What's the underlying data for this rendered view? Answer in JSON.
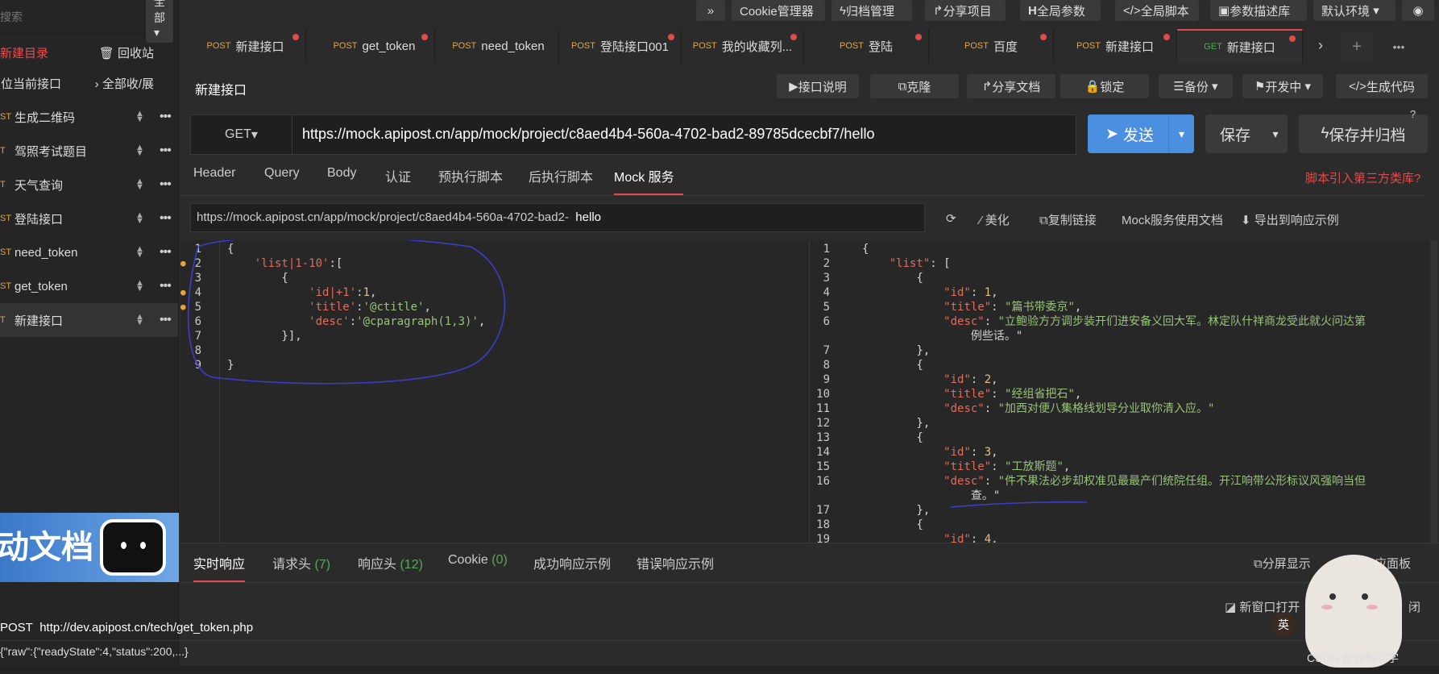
{
  "sidebar": {
    "search_placeholder": "搜索",
    "filter": "全部",
    "new_dir": "新建目录",
    "recycle": "回收站",
    "locate": "定位当前接口",
    "collapse": "全部收/展",
    "items": [
      {
        "method": "ST",
        "label": "生成二维码"
      },
      {
        "method": "T",
        "label": "驾照考试题目"
      },
      {
        "method": "T",
        "label": "天气查询"
      },
      {
        "method": "ST",
        "label": "登陆接口"
      },
      {
        "method": "ST",
        "label": "need_token"
      },
      {
        "method": "ST",
        "label": "get_token"
      },
      {
        "method": "T",
        "label": "新建接口"
      }
    ],
    "promo_text": "动文档"
  },
  "toolbar": {
    "expand": "»",
    "cookie": "Cookie管理器",
    "archive": "归档管理",
    "share_project": "分享项目",
    "global_params": "全局参数",
    "global_script": "全局脚本",
    "param_lib": "参数描述库",
    "env": "默认环境"
  },
  "tabs": [
    {
      "method": "POST",
      "label": "新建接口"
    },
    {
      "method": "POST",
      "label": "get_token"
    },
    {
      "method": "POST",
      "label": "need_token"
    },
    {
      "method": "POST",
      "label": "登陆接口001"
    },
    {
      "method": "POST",
      "label": "我的收藏列..."
    },
    {
      "method": "POST",
      "label": "登陆"
    },
    {
      "method": "POST",
      "label": "百度"
    },
    {
      "method": "POST",
      "label": "新建接口"
    },
    {
      "method": "GET",
      "label": "新建接口"
    }
  ],
  "api": {
    "title": "新建接口",
    "doc": "接口说明",
    "clone": "克隆",
    "share_doc": "分享文档",
    "lock": "锁定",
    "backup": "备份",
    "status": "开发中",
    "gen_code": "生成代码",
    "method": "GET",
    "url": "https://mock.apipost.cn/app/mock/project/c8aed4b4-560a-4702-bad2-89785dcecbf7/hello",
    "send": "发送",
    "save": "保存",
    "save_archive": "保存并归档"
  },
  "req_tabs": [
    "Header",
    "Query",
    "Body",
    "认证",
    "预执行脚本",
    "后执行脚本",
    "Mock 服务"
  ],
  "third_party": "脚本引入第三方类库?",
  "mock": {
    "url_prefix": "https://mock.apipost.cn/app/mock/project/c8aed4b4-560a-4702-bad2-",
    "url_suffix": "hello",
    "beautify": "美化",
    "copy_link": "复制链接",
    "doc": "Mock服务使用文档",
    "export": "导出到响应示例"
  },
  "left_code": [
    "{",
    "    'list|1-10':[",
    "        {",
    "            'id|+1':1,",
    "            'title':'@ctitle',",
    "            'desc':'@cparagraph(1,3)',",
    "        }],",
    "",
    "}"
  ],
  "right_code": [
    {
      "no": "1",
      "text": "{"
    },
    {
      "no": "2",
      "text": "    \"list\": ["
    },
    {
      "no": "3",
      "text": "        {"
    },
    {
      "no": "4",
      "text": "            \"id\": 1,"
    },
    {
      "no": "5",
      "text": "            \"title\": \"篇书带委京\","
    },
    {
      "no": "6",
      "text": "            \"desc\": \"立鲍验方方调步装开们进安备义回大军。林定队什祥商龙受此就火问达第"
    },
    {
      "no": "",
      "text": "                例些话。\""
    },
    {
      "no": "7",
      "text": "        },"
    },
    {
      "no": "8",
      "text": "        {"
    },
    {
      "no": "9",
      "text": "            \"id\": 2,"
    },
    {
      "no": "10",
      "text": "            \"title\": \"经组省把石\","
    },
    {
      "no": "11",
      "text": "            \"desc\": \"加西对便八集格线划导分业取你清入应。\""
    },
    {
      "no": "12",
      "text": "        },"
    },
    {
      "no": "13",
      "text": "        {"
    },
    {
      "no": "14",
      "text": "            \"id\": 3,"
    },
    {
      "no": "15",
      "text": "            \"title\": \"工放斯题\","
    },
    {
      "no": "16",
      "text": "            \"desc\": \"件不果法必步却权准见最最产们统院任组。开江响带公形标议风强响当但"
    },
    {
      "no": "",
      "text": "                查。\""
    },
    {
      "no": "17",
      "text": "        },"
    },
    {
      "no": "18",
      "text": "        {"
    },
    {
      "no": "19",
      "text": "            \"id\": 4,"
    }
  ],
  "bottom": {
    "tabs": [
      {
        "label": "实时响应",
        "count": ""
      },
      {
        "label": "请求头",
        "count": "(7)"
      },
      {
        "label": "响应头",
        "count": "(12)"
      },
      {
        "label": "Cookie",
        "count": "(0)"
      },
      {
        "label": "成功响应示例",
        "count": ""
      },
      {
        "label": "错误响应示例",
        "count": ""
      }
    ],
    "split": "分屏显示",
    "panel": "应面板",
    "new_window": "新窗口打开",
    "close": "闭",
    "log_method": "POST",
    "log_url": "http://dev.apipost.cn/tech/get_token.php",
    "log_raw": "{\"raw\":{\"readyState\":4,\"status\":200,...}",
    "watermark": "CSDN @@桐同学",
    "badge": "英"
  },
  "colors": {
    "accent": "#e04b4b",
    "send": "#4a8fe0",
    "bg": "#2b2b2b"
  }
}
